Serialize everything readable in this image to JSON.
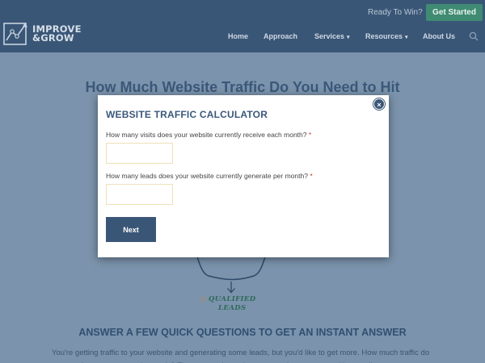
{
  "header": {
    "logo_line1": "IMPROVE",
    "logo_line2": "&GROW",
    "ready_text": "Ready To Win?",
    "cta_label": "Get Started",
    "nav": {
      "home": "Home",
      "approach": "Approach",
      "services": "Services",
      "resources": "Resources",
      "about": "About Us"
    }
  },
  "page": {
    "heading": "How Much Website Traffic Do You Need to Hit",
    "funnel_label_line1": "QUALIFIED",
    "funnel_label_line2": "LEADS",
    "subheading": "ANSWER A FEW QUICK QUESTIONS TO GET AN INSTANT ANSWER",
    "paragraph": "You're getting traffic to your website and generating some leads, but you'd like to get more. How much traffic do you need to get to your sales goals? The answer depends on your sales process and how well your"
  },
  "modal": {
    "title": "WEBSITE TRAFFIC CALCULATOR",
    "close_label": "×",
    "question1": "How many visits does your website currently receive each month?",
    "question2": "How many leads does your website currently generate per month?",
    "required_mark": "*",
    "field1_value": "",
    "field2_value": "",
    "next_label": "Next"
  },
  "colors": {
    "header_bg": "#3a5677",
    "accent_green": "#3f8b73",
    "overlay_bg": "#7b93ac",
    "required": "#c0392b"
  }
}
